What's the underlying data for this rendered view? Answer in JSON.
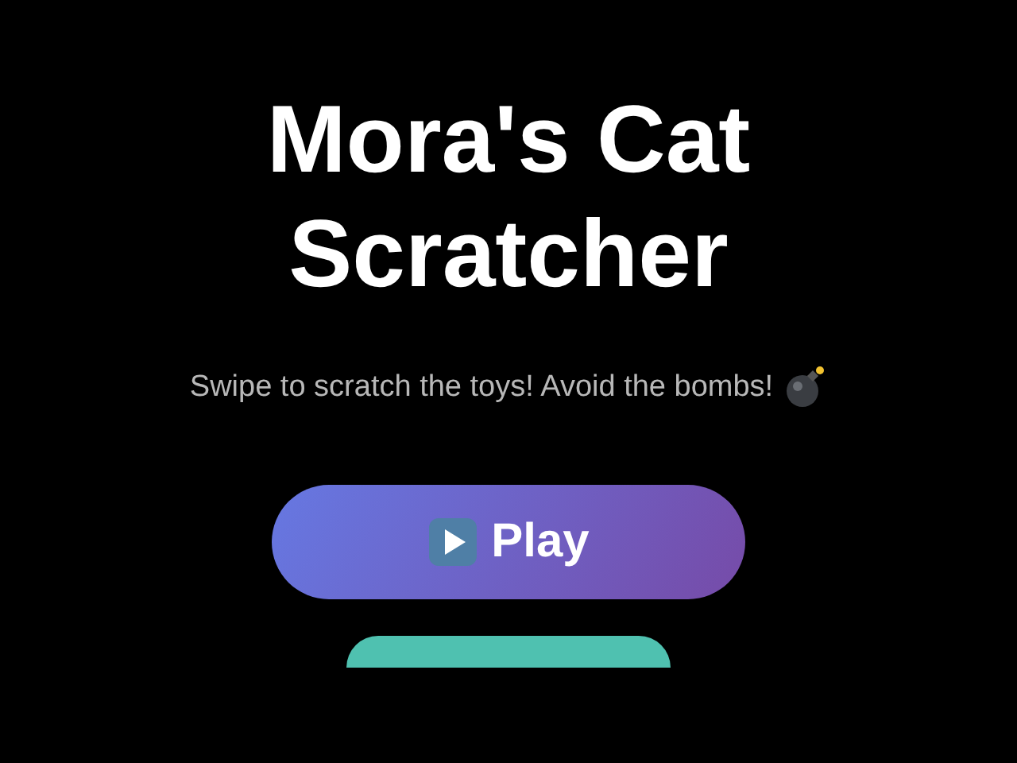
{
  "title": "Mora's Cat Scratcher",
  "subtitle": "Swipe to scratch the toys! Avoid the bombs!",
  "play_button": {
    "label": "Play"
  }
}
